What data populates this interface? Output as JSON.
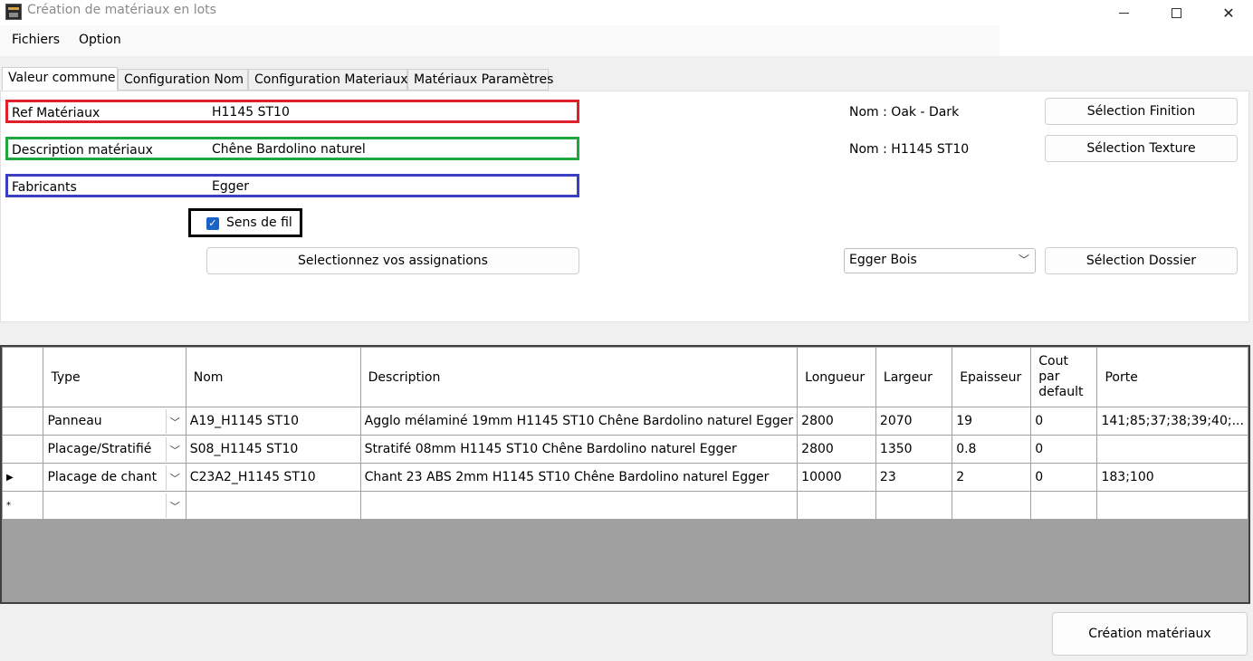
{
  "window": {
    "title": "Création de matériaux en lots"
  },
  "menu": {
    "items": [
      "Fichiers",
      "Option"
    ]
  },
  "tabs": [
    "Valeur commune",
    "Configuration Nom",
    "Configuration Materiaux",
    "Matériaux Paramètres"
  ],
  "form": {
    "ref_label": "Ref Matériaux",
    "ref_value": "H1145 ST10",
    "desc_label": "Description matériaux",
    "desc_value": "Chêne Bardolino naturel",
    "fab_label": "Fabricants",
    "fab_value": "Egger",
    "sens_label": "Sens de fil",
    "sens_checked": true,
    "assign_button": "Selectionnez vos assignations",
    "nom_finition": "Nom : Oak - Dark",
    "nom_texture": "Nom : H1145 ST10",
    "finition_button": "Sélection Finition",
    "texture_button": "Sélection Texture",
    "folder_select": "Egger Bois",
    "folder_button": "Sélection Dossier"
  },
  "grid": {
    "headers": [
      "Type",
      "Nom",
      "Description",
      "Longueur",
      "Largeur",
      "Epaisseur",
      "Cout par default",
      "Porte"
    ],
    "rows": [
      {
        "marker": "",
        "type": "Panneau",
        "nom": "A19_H1145 ST10",
        "description": "Agglo mélaminé 19mm H1145 ST10 Chêne Bardolino naturel Egger",
        "longueur": "2800",
        "largeur": "2070",
        "epaisseur": "19",
        "cout": "0",
        "porte": "141;85;37;38;39;40;..."
      },
      {
        "marker": "",
        "type": "Placage/Stratifié",
        "nom": "S08_H1145 ST10",
        "description": "Stratifé 08mm H1145 ST10 Chêne Bardolino naturel Egger",
        "longueur": "2800",
        "largeur": "1350",
        "epaisseur": "0.8",
        "cout": "0",
        "porte": ""
      },
      {
        "marker": "▶",
        "type": "Placage de chant",
        "nom": "C23A2_H1145 ST10",
        "description": "Chant 23 ABS 2mm H1145 ST10 Chêne Bardolino naturel Egger",
        "longueur": "10000",
        "largeur": "23",
        "epaisseur": "2",
        "cout": "0",
        "porte": "183;100"
      },
      {
        "marker": "*",
        "type": "",
        "nom": "",
        "description": "",
        "longueur": "",
        "largeur": "",
        "epaisseur": "",
        "cout": "",
        "porte": ""
      }
    ]
  },
  "create_button": "Création matériaux",
  "colors": {
    "ref_border": "#e0202b",
    "desc_border": "#1ea83b",
    "fab_border": "#3a3fc4",
    "checkbox": "#1a64c8"
  }
}
